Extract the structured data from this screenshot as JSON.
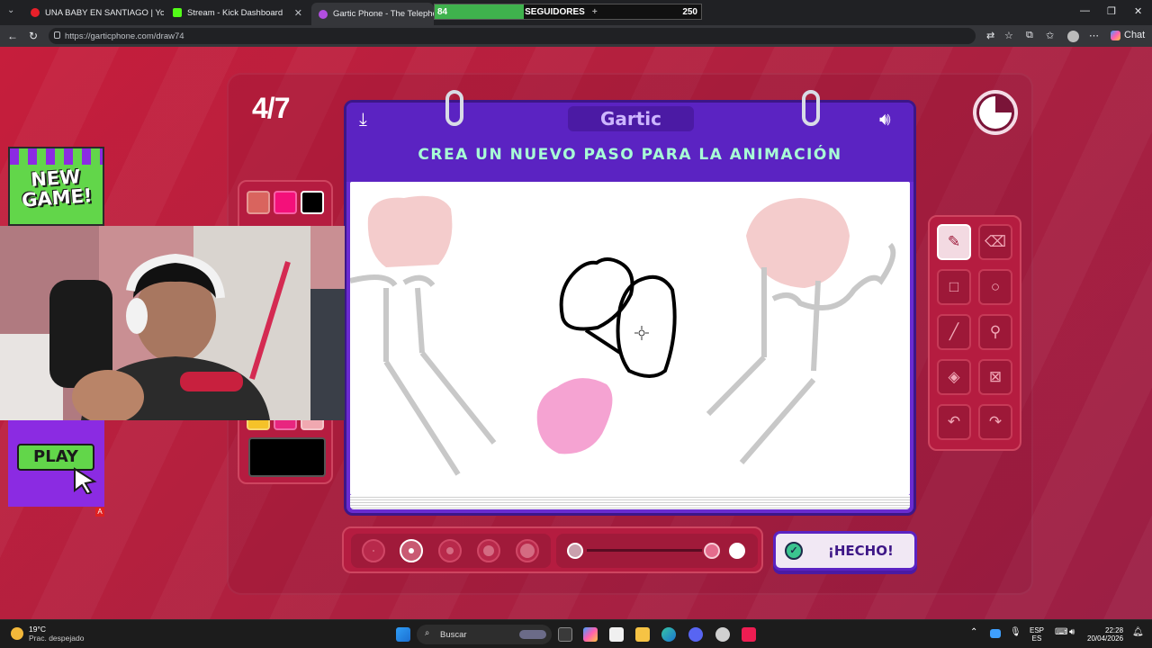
{
  "browser": {
    "tabs": [
      {
        "title": "UNA BABY EN SANTIAGO | Yo",
        "favicon_color": "#e8202a"
      },
      {
        "title": "Stream - Kick Dashboard",
        "favicon_color": "#53fc18"
      },
      {
        "title": "Gartic Phone - The Telephone Ga",
        "favicon_color": "#b24ee0"
      }
    ],
    "active_tab": 2,
    "url": "https://garticphone.com/draw74",
    "chat_label": "Chat"
  },
  "follower_goal": {
    "current": "84",
    "label": "SEGUIDORES",
    "target": "250",
    "progress": 0.336
  },
  "game": {
    "round": "4/7",
    "logo": "Gartic",
    "instruction": "CREA UN NUEVO PASO PARA LA ANIMACIÓN",
    "palette": [
      "#d9645e",
      "#f4107a",
      "#000000",
      "#f5c229",
      "#e8257f",
      "#f0a8b0"
    ],
    "selected_color": "#000000",
    "tools": [
      "pencil",
      "eraser",
      "rectangle",
      "ellipse",
      "line",
      "eyedropper",
      "fill",
      "clear",
      "undo",
      "redo"
    ],
    "selected_tool": "pencil",
    "brush_sizes": 5,
    "selected_brush_size": 2,
    "opacity_level": 1,
    "done_label": "¡HECHO!",
    "timer_remaining": 0.75
  },
  "overlays": {
    "new_game": "NEW GAME!",
    "play": "PLAY",
    "badge": "A"
  },
  "taskbar": {
    "temperature": "19°C",
    "weather": "Prac. despejado",
    "search_placeholder": "Buscar",
    "lang_1": "ESP",
    "lang_2": "ES",
    "time": "22:28",
    "date": "20/04/2026"
  }
}
